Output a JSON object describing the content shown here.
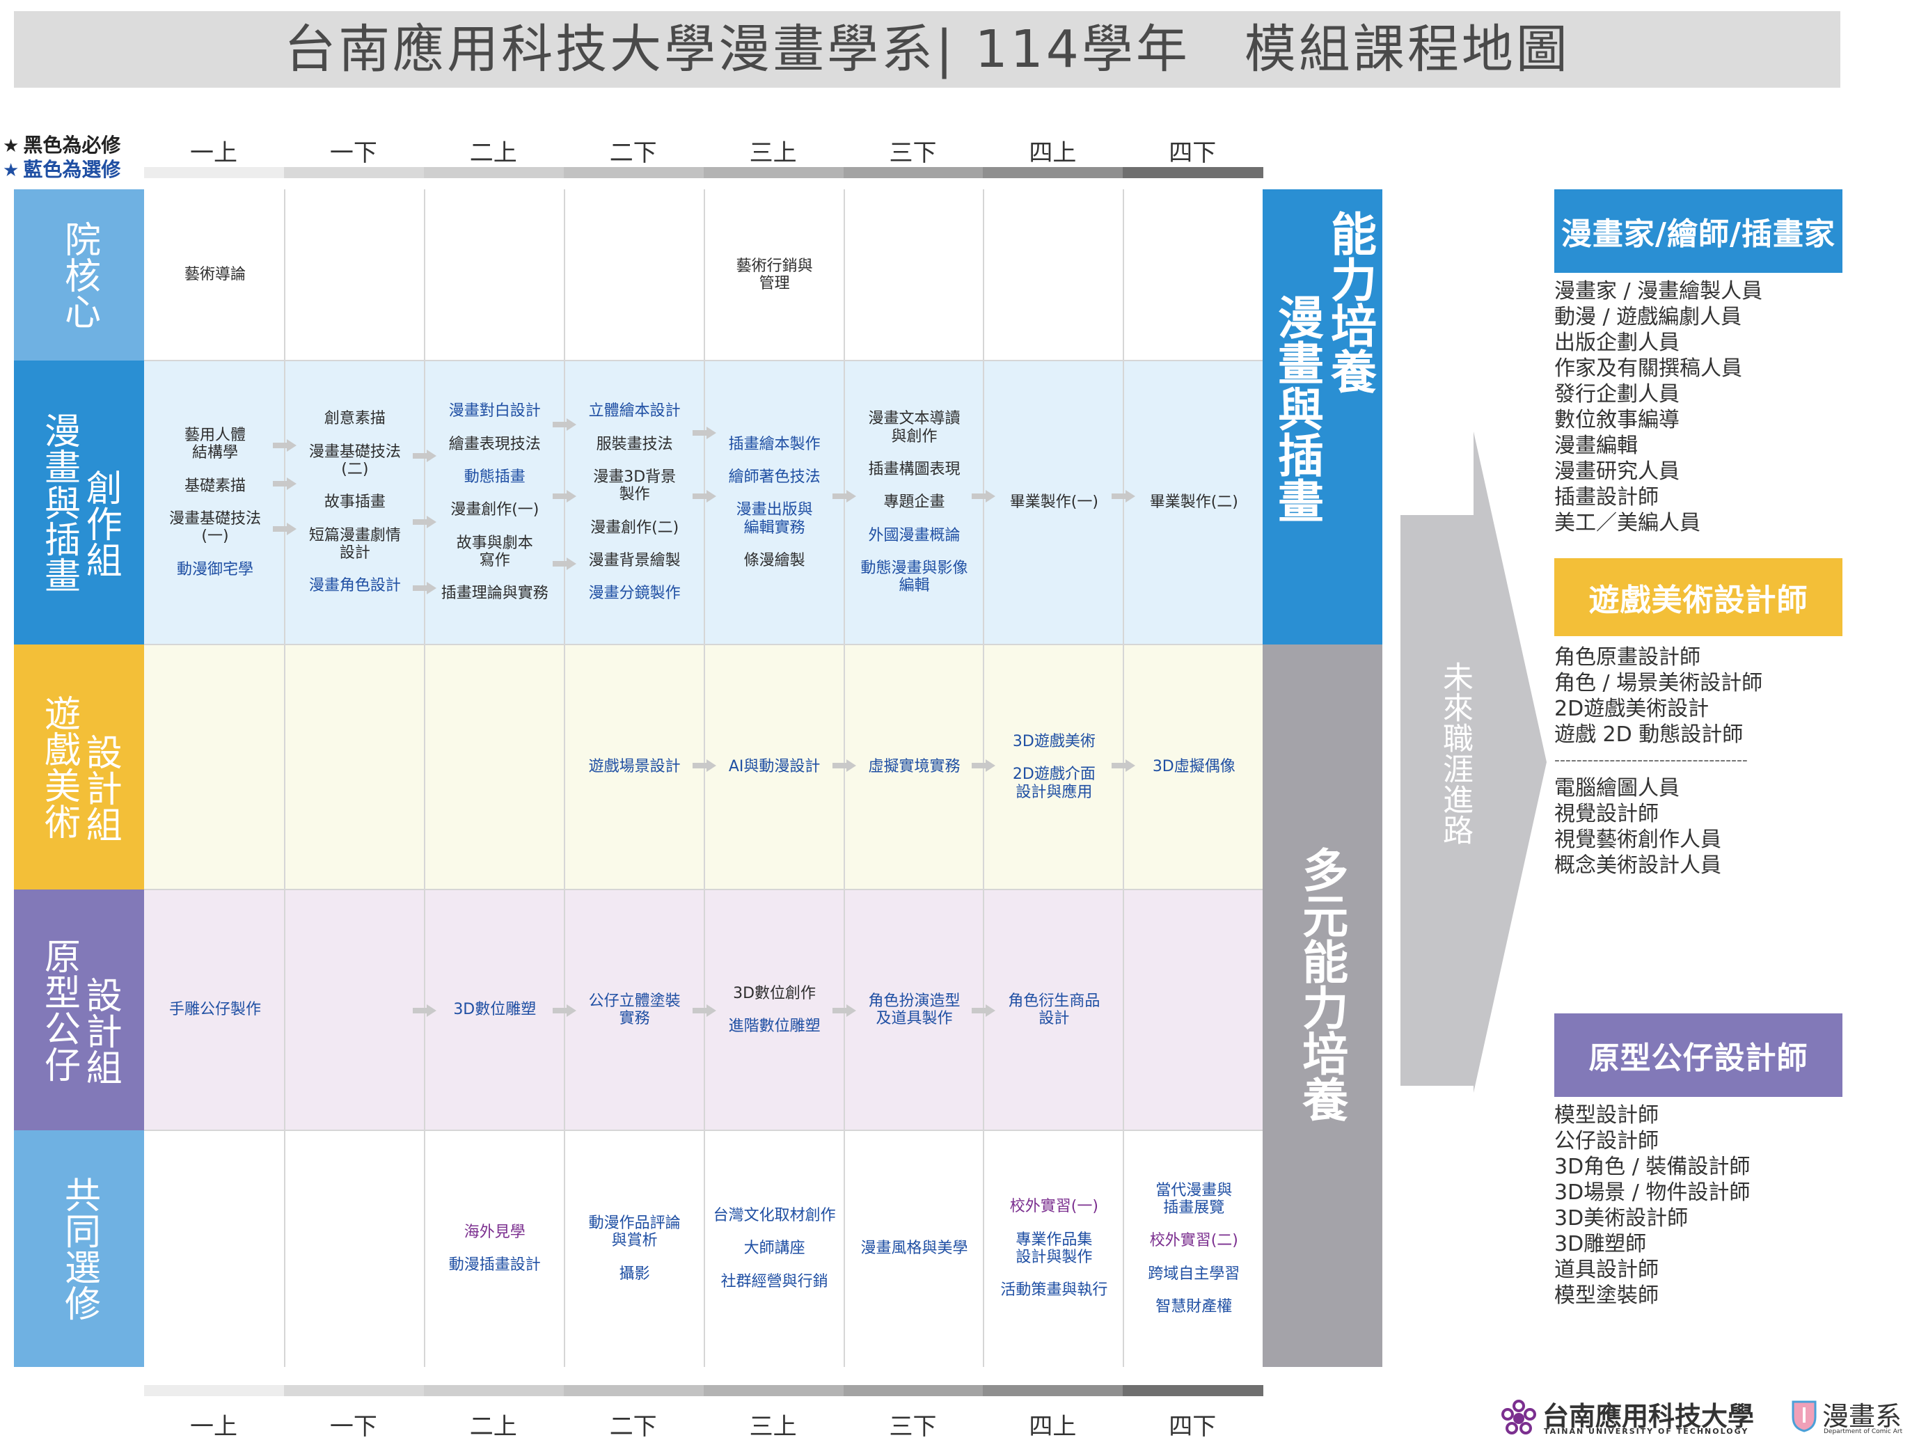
{
  "title": "台南應用科技大學漫畫學系| 114學年　模組課程地圖",
  "legend": {
    "required": "黑色為必修",
    "elective": "藍色為選修",
    "star": "★"
  },
  "semesters": [
    "一上",
    "一下",
    "二上",
    "二下",
    "三上",
    "三下",
    "四上",
    "四下"
  ],
  "rows": {
    "core": {
      "label": "院核心"
    },
    "comic": {
      "label_a": "漫畫與插畫",
      "label_b": "創作組"
    },
    "game": {
      "label_a": "遊戲美術",
      "label_b": "設計組"
    },
    "proto": {
      "label_a": "原型公仔",
      "label_b": "設計組"
    },
    "common": {
      "label": "共同選修"
    }
  },
  "courses": {
    "core": {
      "s1": [
        "藝術導論"
      ],
      "s5": [
        "藝術行銷與\n管理"
      ]
    },
    "comic": {
      "s1": [
        {
          "t": "藝用人體\n結構學",
          "c": "k"
        },
        {
          "t": "基礎素描",
          "c": "k"
        },
        {
          "t": "漫畫基礎技法\n(一)",
          "c": "k"
        },
        {
          "t": "動漫御宅學",
          "c": "b"
        }
      ],
      "s2": [
        {
          "t": "創意素描",
          "c": "k"
        },
        {
          "t": "漫畫基礎技法\n(二)",
          "c": "k"
        },
        {
          "t": "故事插畫",
          "c": "k"
        },
        {
          "t": "短篇漫畫劇情\n設計",
          "c": "k"
        },
        {
          "t": "漫畫角色設計",
          "c": "b"
        }
      ],
      "s3": [
        {
          "t": "漫畫對白設計",
          "c": "b"
        },
        {
          "t": "繪畫表現技法",
          "c": "k"
        },
        {
          "t": "動態插畫",
          "c": "b"
        },
        {
          "t": "漫畫創作(一)",
          "c": "k"
        },
        {
          "t": "故事與劇本\n寫作",
          "c": "k"
        },
        {
          "t": "插畫理論與實務",
          "c": "k"
        }
      ],
      "s4": [
        {
          "t": "立體繪本設計",
          "c": "b"
        },
        {
          "t": "服裝畫技法",
          "c": "k"
        },
        {
          "t": "漫畫3D背景\n製作",
          "c": "k"
        },
        {
          "t": "漫畫創作(二)",
          "c": "k"
        },
        {
          "t": "漫畫背景繪製",
          "c": "k"
        },
        {
          "t": "漫畫分鏡製作",
          "c": "b"
        }
      ],
      "s5": [
        {
          "t": "插畫繪本製作",
          "c": "b"
        },
        {
          "t": "繪師著色技法",
          "c": "b"
        },
        {
          "t": "漫畫出版與\n編輯實務",
          "c": "b"
        },
        {
          "t": "條漫繪製",
          "c": "k"
        }
      ],
      "s6": [
        {
          "t": "漫畫文本導讀\n與創作",
          "c": "k"
        },
        {
          "t": "插畫構圖表現",
          "c": "k"
        },
        {
          "t": "專題企畫",
          "c": "k"
        },
        {
          "t": "外國漫畫概論",
          "c": "b"
        },
        {
          "t": "動態漫畫與影像\n編輯",
          "c": "b"
        }
      ],
      "s7": [
        {
          "t": "畢業製作(一)",
          "c": "k"
        }
      ],
      "s8": [
        {
          "t": "畢業製作(二)",
          "c": "k"
        }
      ]
    },
    "game": {
      "s4": [
        {
          "t": "遊戲場景設計",
          "c": "b"
        }
      ],
      "s5": [
        {
          "t": "AI與動漫設計",
          "c": "b"
        }
      ],
      "s6": [
        {
          "t": "虛擬實境實務",
          "c": "b"
        }
      ],
      "s7": [
        {
          "t": "3D遊戲美術",
          "c": "b"
        },
        {
          "t": "2D遊戲介面\n設計與應用",
          "c": "b"
        }
      ],
      "s8": [
        {
          "t": "3D虛擬偶像",
          "c": "b"
        }
      ]
    },
    "proto": {
      "s1": [
        {
          "t": "手雕公仔製作",
          "c": "b"
        }
      ],
      "s3": [
        {
          "t": "3D數位雕塑",
          "c": "b"
        }
      ],
      "s4": [
        {
          "t": "公仔立體塗裝\n實務",
          "c": "b"
        }
      ],
      "s5": [
        {
          "t": "3D數位創作",
          "c": "k"
        },
        {
          "t": "進階數位雕塑",
          "c": "b"
        }
      ],
      "s6": [
        {
          "t": "角色扮演造型\n及道具製作",
          "c": "b"
        }
      ],
      "s7": [
        {
          "t": "角色衍生商品\n設計",
          "c": "b"
        }
      ]
    },
    "common": {
      "s3": [
        {
          "t": "海外見學",
          "c": "p"
        },
        {
          "t": "動漫插畫設計",
          "c": "b"
        }
      ],
      "s4": [
        {
          "t": "動漫作品評論\n與賞析",
          "c": "b"
        },
        {
          "t": "攝影",
          "c": "b"
        }
      ],
      "s5": [
        {
          "t": "台灣文化取材創作",
          "c": "b"
        },
        {
          "t": "大師講座",
          "c": "b"
        },
        {
          "t": "社群經營與行銷",
          "c": "b"
        }
      ],
      "s6": [
        {
          "t": "漫畫風格與美學",
          "c": "b"
        }
      ],
      "s7": [
        {
          "t": "校外實習(一)",
          "c": "p"
        },
        {
          "t": "專業作品集\n設計與製作",
          "c": "b"
        },
        {
          "t": "活動策畫與執行",
          "c": "b"
        }
      ],
      "s8": [
        {
          "t": "當代漫畫與\n插畫展覽",
          "c": "b"
        },
        {
          "t": "校外實習(二)",
          "c": "p"
        },
        {
          "t": "跨域自主學習",
          "c": "b"
        },
        {
          "t": "智慧財產權",
          "c": "b"
        }
      ]
    }
  },
  "capability": {
    "top_a": "能力培養",
    "top_b": "漫畫與插畫",
    "bottom": "多元能力培養"
  },
  "career": {
    "arrow_label": "未來職涯進路",
    "groups": [
      {
        "title": "漫畫家/繪師/插畫家",
        "color": "#2a8fd3",
        "items": [
          "漫畫家 / 漫畫繪製人員",
          "動漫 / 遊戲編劇人員",
          "出版企劃人員",
          "作家及有關撰稿人員",
          "發行企劃人員",
          "數位敘事編導",
          "漫畫編輯",
          "漫畫研究人員",
          "插畫設計師",
          "美工／美編人員"
        ]
      },
      {
        "title": "遊戲美術設計師",
        "color": "#f3bf38",
        "items": [
          "角色原畫設計師",
          "角色 / 場景美術設計師",
          "2D遊戲美術設計",
          "遊戲 2D 動態設計師"
        ],
        "divider": "-----------------------------------",
        "items2": [
          "電腦繪圖人員",
          "視覺設計師",
          "視覺藝術創作人員",
          "概念美術設計人員"
        ]
      },
      {
        "title": "原型公仔設計師",
        "color": "#8279b8",
        "items": [
          "模型設計師",
          "公仔設計師",
          "3D角色 / 裝備設計師",
          "3D場景 / 物件設計師",
          "3D美術設計師",
          "3D雕塑師",
          "道具設計師",
          "模型塗裝師"
        ]
      }
    ]
  },
  "footer": {
    "school": "台南應用科技大學",
    "school_en": "TAINAN UNIVERSITY OF TECHNOLOGY",
    "dept": "漫畫系",
    "dept_en": "Department of Comic Art"
  },
  "colors": {
    "core": "#6fb1e2",
    "comic": "#2a8fd3",
    "game": "#f3bf38",
    "proto": "#8279b8",
    "common": "#6fb1e2",
    "comic_bg": "#e2f1fb",
    "game_bg": "#fafaea",
    "proto_bg": "#f2e9f3"
  }
}
